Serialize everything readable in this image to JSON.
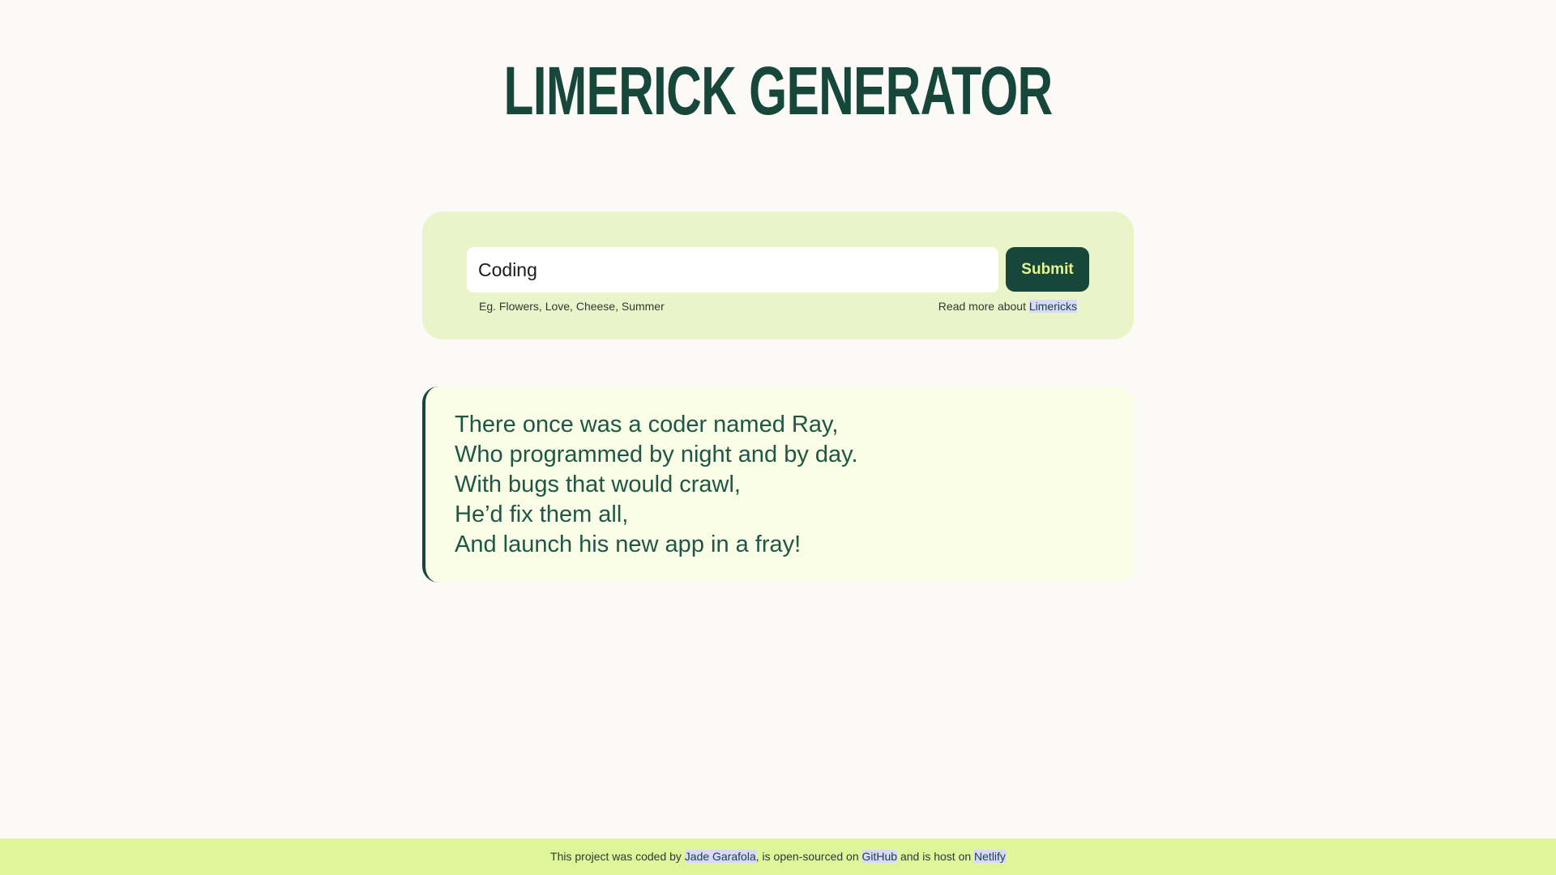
{
  "header": {
    "title": "LIMERICK GENERATOR"
  },
  "form": {
    "input_value": "Coding",
    "submit_label": "Submit",
    "hint": "Eg. Flowers, Love, Cheese, Summer",
    "readmore_prefix": "Read more about",
    "readmore_link": "Limericks"
  },
  "poem": {
    "lines": [
      "There once was a coder named Ray,",
      "Who programmed by night and by day.",
      "With bugs that would crawl,",
      "He’d fix them all,",
      "And launch his new app in a fray!"
    ]
  },
  "footer": {
    "text1": "This project was coded by",
    "author_link": "Jade Garafola",
    "text2": ", is open-sourced on",
    "github_link": "GitHub",
    "text3": "and is host on",
    "netlify_link": "Netlify"
  },
  "colors": {
    "primary": "#17473a",
    "background": "#fbfaf6",
    "form_bg": "#e9f4c9",
    "poem_bg": "#fbfee6",
    "footer_bg": "#def59a",
    "button_text": "#e6f58d",
    "link_highlight": "#d9d8ff"
  }
}
